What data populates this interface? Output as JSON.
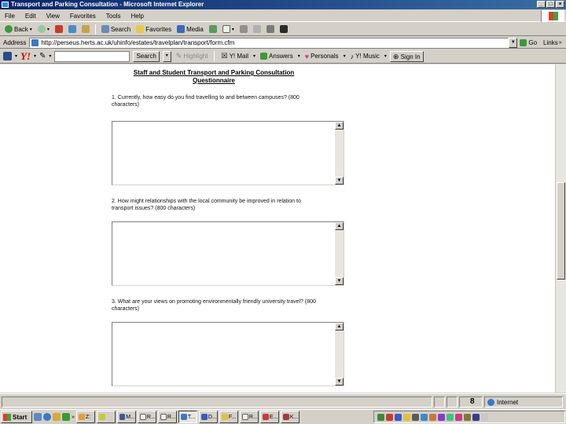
{
  "window": {
    "title": "Transport and Parking Consultation - Microsoft Internet Explorer",
    "buttons": [
      "_",
      "□",
      "×"
    ]
  },
  "menu": [
    "File",
    "Edit",
    "View",
    "Favorites",
    "Tools",
    "Help"
  ],
  "toolbar": {
    "back": "Back",
    "search": "Search",
    "favorites": "Favorites",
    "media": "Media"
  },
  "address": {
    "label": "Address",
    "url": "http://perseus.herts.ac.uk/uhinfo/estates/travelplan/transport/form.cfm",
    "go": "Go",
    "links": "Links"
  },
  "yahoo": {
    "search_button": "Search",
    "highlight": "Highlight",
    "mail": "Y! Mail",
    "answers": "Answers",
    "personals": "Personals",
    "music": "Y! Music",
    "sign_in": "Sign In"
  },
  "page": {
    "title_line1": "Staff and Student Transport and Parking Consultation",
    "title_line2": "Questionnaire",
    "questions": [
      "1. Currently, how easy do you find travelling to and between campuses? (800 characters)",
      "2. How might relationships with the local community be improved in relation to transport issues? (800 characters)",
      "3. What are your views on promoting environmentally friendly university travel? (800 characters)"
    ]
  },
  "status": {
    "page_number": "8",
    "zone": "Internet"
  },
  "taskbar": {
    "start": "Start",
    "tasks": [
      "Z:",
      "",
      "M...",
      "R...",
      "R...",
      "T...",
      "D...",
      "F...",
      "R...",
      "E...",
      "K..."
    ],
    "clock": ""
  }
}
